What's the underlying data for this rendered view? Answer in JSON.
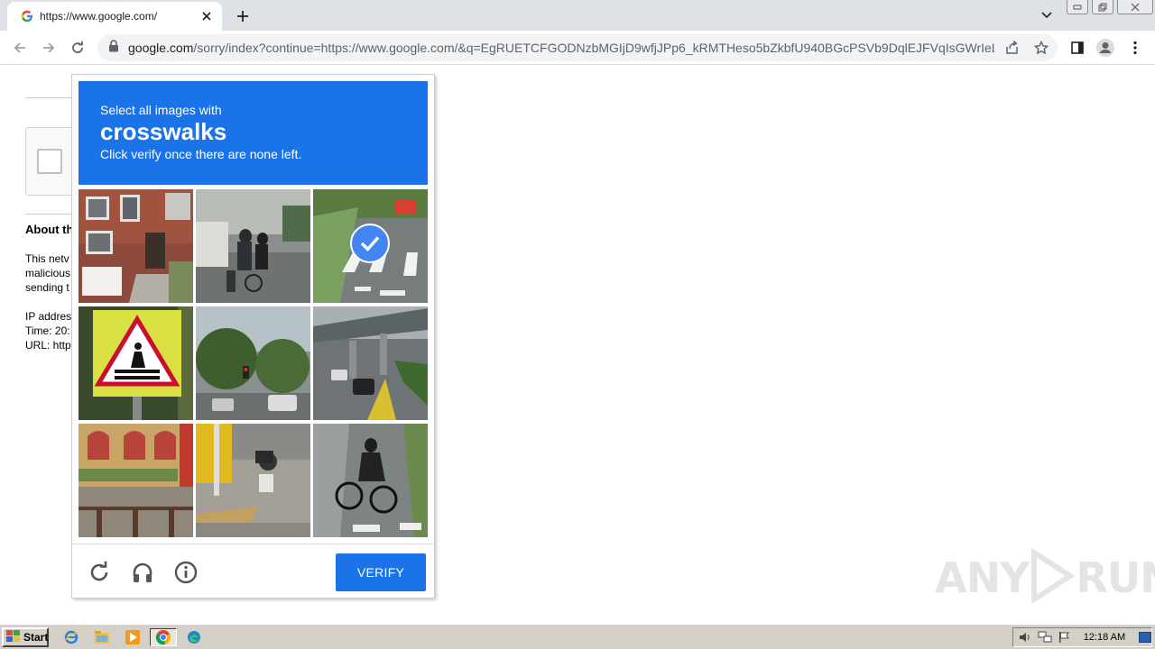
{
  "browser": {
    "tab_title": "https://www.google.com/",
    "url_host": "google.com",
    "url_rest": "/sorry/index?continue=https://www.google.com/&q=EgRUETCFGODNzbMGIjD9wfjJPp6_kRMTHeso5bZkbfU940BGcPSVb9DqlEJFVqIsGWrIeLui..."
  },
  "background_page": {
    "about_heading": "About th",
    "lines": [
      "This netv",
      "malicious",
      "sending t"
    ],
    "ip_line": "IP addres",
    "time_line": "Time: 20:",
    "url_line": "URL: http"
  },
  "captcha": {
    "instruction_line1": "Select all images with",
    "target_word": "crosswalks",
    "instruction_line3": "Click verify once there are none left.",
    "verify_label": "VERIFY",
    "tiles": [
      {
        "subject": "house",
        "selected": false
      },
      {
        "subject": "street-cyclists",
        "selected": false
      },
      {
        "subject": "crosswalk-road",
        "selected": true
      },
      {
        "subject": "pedestrian-crossing-sign",
        "selected": false
      },
      {
        "subject": "traffic-light-street",
        "selected": false
      },
      {
        "subject": "highway-overpass",
        "selected": false
      },
      {
        "subject": "building-facade",
        "selected": false
      },
      {
        "subject": "sidewalk-motorbike",
        "selected": false
      },
      {
        "subject": "cyclist-crosswalk",
        "selected": false
      }
    ],
    "colors": {
      "header": "#1a73e8",
      "button": "#1a73e8",
      "check": "#4285f4"
    }
  },
  "watermark": {
    "text_left": "ANY",
    "text_right": "RUN"
  },
  "taskbar": {
    "start_label": "Start",
    "clock": "12:18 AM"
  }
}
